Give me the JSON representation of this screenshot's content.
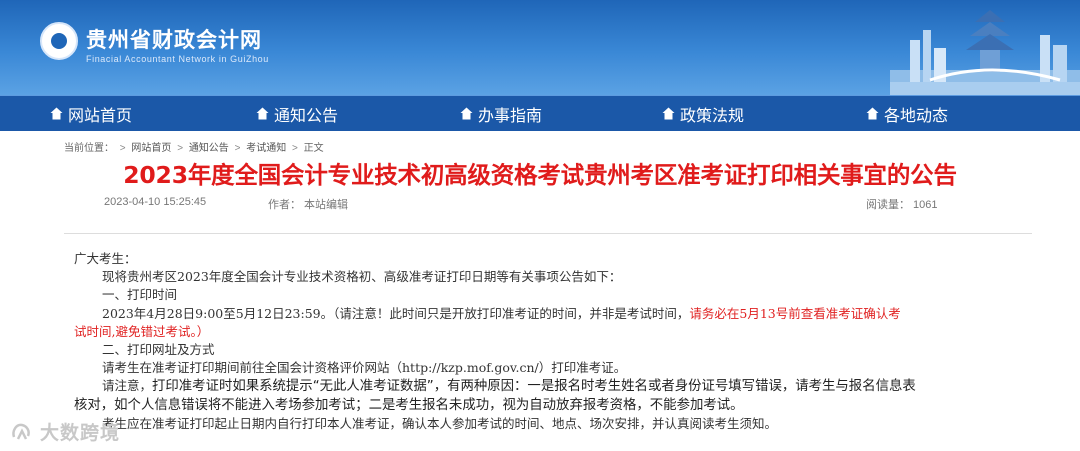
{
  "header": {
    "site_title": "贵州省财政会计网",
    "site_subtitle": "Finacial  Accountant Network in GuiZhou"
  },
  "nav": {
    "items": [
      {
        "label": "网站首页",
        "icon": "home-icon"
      },
      {
        "label": "通知公告",
        "icon": "home-icon"
      },
      {
        "label": "办事指南",
        "icon": "home-icon"
      },
      {
        "label": "政策法规",
        "icon": "home-icon"
      },
      {
        "label": "各地动态",
        "icon": "home-icon"
      }
    ]
  },
  "breadcrumb": {
    "prefix": "当前位置：",
    "items": [
      "网站首页",
      "通知公告",
      "考试通知",
      "正文"
    ],
    "separator": ">"
  },
  "article": {
    "title": "2023年度全国会计专业技术初高级资格考试贵州考区准考证打印相关事宜的公告",
    "date": "2023-04-10 15:25:45",
    "author": "作者：  本站编辑",
    "views": "阅读量：  1061",
    "salutation": "广大考生：",
    "intro": "现将贵州考区2023年度全国会计专业技术资格初、高级准考证打印日期等有关事项公告如下：",
    "section1_heading": "一、打印时间",
    "section1_text": "2023年4月28日9:00至5月12日23:59。（请注意！此时间只是开放打印准考证的时间，并非是考试时间，",
    "section1_red_1": "请务必在5月13号前查看准考证确认考",
    "section1_red_2": "试时间,避免错过考试。）",
    "section2_heading": "二、打印网址及方式",
    "section2_text": "请考生在准考证打印期间前往全国会计资格评价网站（http://kzp.mof.gov.cn/）打印准考证。",
    "notice_prefix": "请注意，",
    "notice_line1": "打印准考证时如果系统提示“无此人准考证数据”，有两种原因：一是报名时考生姓名或者身份证号填写错误，请考生与报名信息表",
    "notice_line2": "核对，如个人信息错误将不能进入考场参加考试；二是考生报名未成功，视为自动放弃报考资格，不能参加考试。",
    "final_text": "考生应在准考证打印起止日期内自行打印本人准考证，确认本人参加考试的时间、地点、场次安排，并认真阅读考生须知。"
  },
  "watermark": {
    "text": "大数跨境"
  },
  "colors": {
    "banner": "#2f7cd0",
    "nav": "#1b58a8",
    "title_red": "#e01b1b",
    "highlight_red": "#e02222"
  }
}
